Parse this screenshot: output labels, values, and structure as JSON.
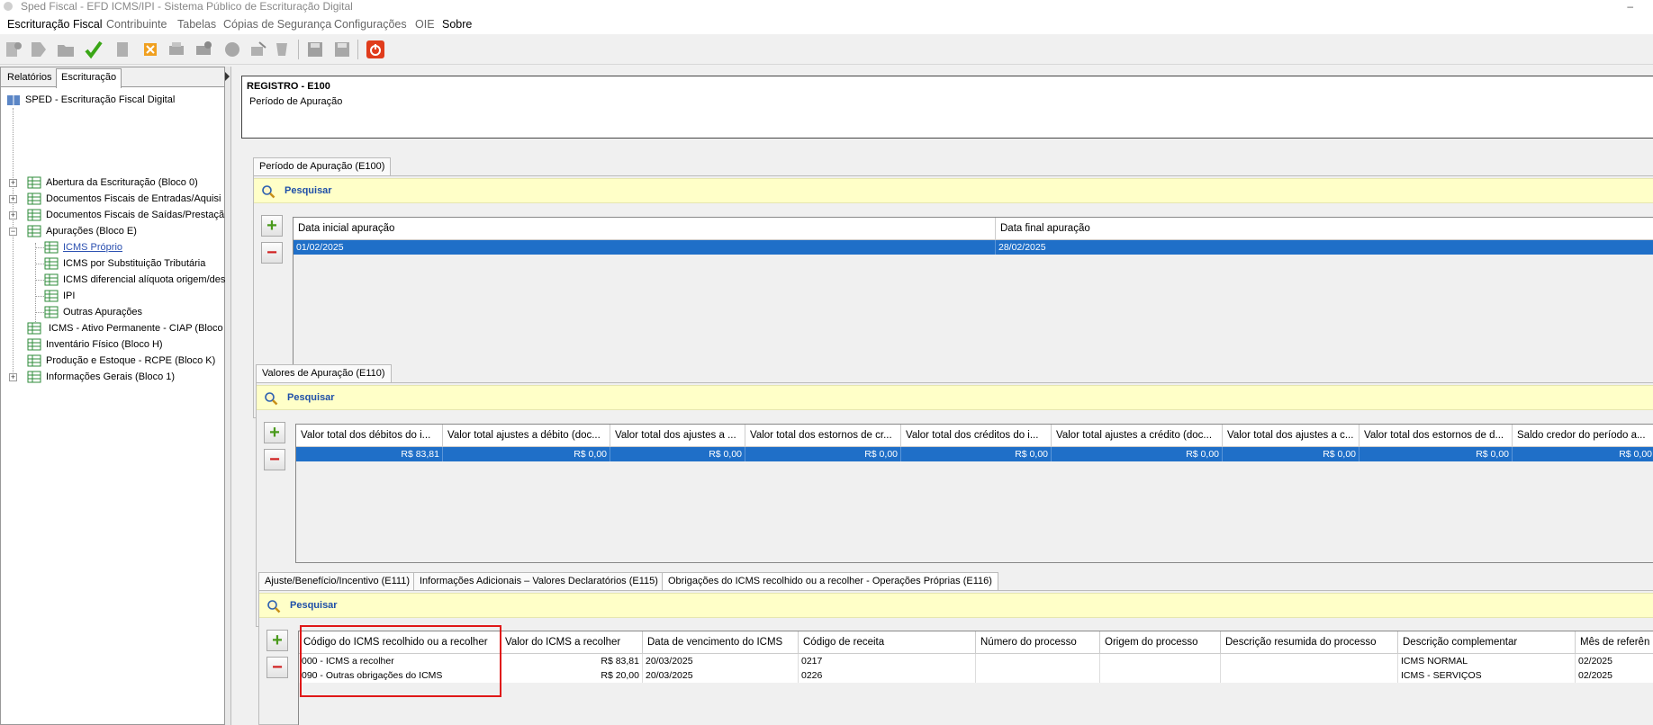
{
  "window": {
    "title": "Sped Fiscal - EFD ICMS/IPI - Sistema Público de Escrituração Digital",
    "minimize": "–"
  },
  "menu": [
    {
      "label": "Escrituração Fiscal",
      "enabled": true
    },
    {
      "label": "Contribuinte",
      "enabled": false
    },
    {
      "label": "Tabelas",
      "enabled": false
    },
    {
      "label": "Cópias de Segurança",
      "enabled": false
    },
    {
      "label": "Configurações",
      "enabled": false
    },
    {
      "label": "OIE",
      "enabled": false
    },
    {
      "label": "Sobre",
      "enabled": true
    }
  ],
  "left_panel": {
    "tabs": [
      "Relatórios",
      "Escrituração"
    ],
    "active_tab": "Escrituração",
    "tree": {
      "root": "SPED - Escrituração Fiscal Digital",
      "items": [
        "Abertura da Escrituração (Bloco 0)",
        "Documentos Fiscais de Entradas/Aquisi",
        "Documentos Fiscais de Saídas/Prestaçã",
        "Apurações (Bloco E)",
        "ICMS Próprio",
        "ICMS por Substituição Tributária",
        "ICMS diferencial alíquota origem/des",
        "IPI",
        "Outras Apurações",
        "ICMS - Ativo Permanente - CIAP (Bloco",
        "Inventário Físico (Bloco H)",
        "Produção e Estoque - RCPE (Bloco K)",
        "Informações Gerais (Bloco 1)"
      ]
    }
  },
  "record": {
    "title": "REGISTRO - E100",
    "subtitle": "Período de Apuração"
  },
  "search_label": "Pesquisar",
  "e100": {
    "tab": "Período de Apuração (E100)",
    "columns": [
      "Data inicial apuração",
      "Data final apuração"
    ],
    "rows": [
      [
        "01/02/2025",
        "28/02/2025"
      ]
    ]
  },
  "e110": {
    "tab": "Valores de Apuração (E110)",
    "columns": [
      "Valor total dos débitos do i...",
      "Valor total ajustes a débito (doc...",
      "Valor total dos ajustes a ...",
      "Valor total dos estornos de cr...",
      "Valor total dos créditos do i...",
      "Valor total ajustes a crédito (doc...",
      "Valor total dos ajustes a c...",
      "Valor total dos estornos de d...",
      "Saldo credor do período a..."
    ],
    "rows": [
      [
        "R$ 83,81",
        "R$ 0,00",
        "R$ 0,00",
        "R$ 0,00",
        "R$ 0,00",
        "R$ 0,00",
        "R$ 0,00",
        "R$ 0,00",
        "R$ 0,00"
      ]
    ]
  },
  "sub_tabs": [
    "Ajuste/Benefício/Incentivo (E111)",
    "Informações Adicionais – Valores Declaratórios (E115)",
    "Obrigações do ICMS recolhido ou a recolher - Operações Próprias (E116)"
  ],
  "e116": {
    "columns": [
      "Código do ICMS recolhido ou a recolher",
      "Valor do ICMS a recolher",
      "Data de vencimento do ICMS",
      "Código de receita",
      "Número do processo",
      "Origem do processo",
      "Descrição resumida do processo",
      "Descrição complementar",
      "Mês de referên"
    ],
    "rows": [
      [
        "000 - ICMS a recolher",
        "R$ 83,81",
        "20/03/2025",
        "0217",
        "",
        "",
        "",
        "ICMS NORMAL",
        "02/2025"
      ],
      [
        "090 - Outras obrigações do ICMS",
        "R$ 20,00",
        "20/03/2025",
        "0226",
        "",
        "",
        "",
        "ICMS - SERVIÇOS",
        "02/2025"
      ]
    ]
  },
  "colors": {
    "selection": "#1f6fc8",
    "search_bar": "#ffffc8",
    "search_text": "#1f4fa8",
    "highlight": "#e01818"
  }
}
